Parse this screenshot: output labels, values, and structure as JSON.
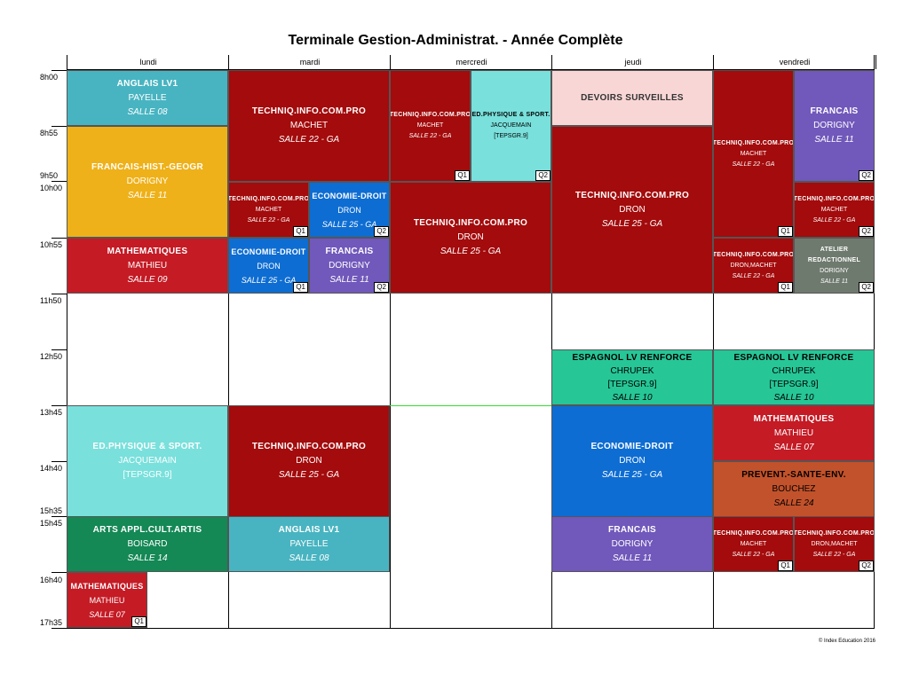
{
  "title": "Terminale Gestion-Administrat. - Année Complète",
  "days": [
    "lundi",
    "mardi",
    "mercredi",
    "jeudi",
    "vendredi"
  ],
  "times": [
    "8h00",
    "8h55",
    "9h50",
    "10h00",
    "10h55",
    "11h50",
    "12h50",
    "13h45",
    "14h40",
    "15h35",
    "15h45",
    "16h40",
    "17h35"
  ],
  "footer": "© Index Education 2016",
  "colors": {
    "teal": "#48b4c1",
    "orange": "#efb119",
    "red": "#c41b25",
    "darkred": "#a30b0c",
    "cyan": "#79e0dc",
    "pink": "#f9d6d6",
    "blue": "#0e6dd2",
    "purple": "#7158bb",
    "grey": "#6f7a6e",
    "green": "#26c697",
    "darkgreen": "#148855",
    "rust": "#c2522b"
  },
  "courses": [
    {
      "subject": "ANGLAIS LV1",
      "teacher": "PAYELLE",
      "room": "SALLE 08",
      "extra": "",
      "group": "",
      "color": "teal"
    },
    {
      "subject": "FRANCAIS-HIST.-GEOGR",
      "teacher": "DORIGNY",
      "room": "SALLE 11",
      "extra": "",
      "group": "",
      "color": "orange"
    },
    {
      "subject": "MATHEMATIQUES",
      "teacher": "MATHIEU",
      "room": "SALLE 09",
      "extra": "",
      "group": "",
      "color": "red"
    },
    {
      "subject": "ED.PHYSIQUE & SPORT.",
      "teacher": "JACQUEMAIN",
      "room": "",
      "extra": "[TEPSGR.9]",
      "group": "",
      "color": "cyan"
    },
    {
      "subject": "ARTS APPL.CULT.ARTIS",
      "teacher": "BOISARD",
      "room": "SALLE 14",
      "extra": "",
      "group": "",
      "color": "darkgreen"
    },
    {
      "subject": "MATHEMATIQUES",
      "teacher": "MATHIEU",
      "room": "SALLE 07",
      "extra": "",
      "group": "Q1",
      "color": "red"
    },
    {
      "subject": "TECHNIQ.INFO.COM.PRO",
      "teacher": "MACHET",
      "room": "SALLE 22 - GA",
      "extra": "",
      "group": "",
      "color": "darkred"
    },
    {
      "subject": "TECHNIQ.INFO.COM.PRO",
      "teacher": "MACHET",
      "room": "SALLE 22 - GA",
      "extra": "",
      "group": "Q1",
      "color": "darkred"
    },
    {
      "subject": "ECONOMIE-DROIT",
      "teacher": "DRON",
      "room": "SALLE 25 - GA",
      "extra": "",
      "group": "Q2",
      "color": "blue"
    },
    {
      "subject": "ECONOMIE-DROIT",
      "teacher": "DRON",
      "room": "SALLE 25 - GA",
      "extra": "",
      "group": "Q1",
      "color": "blue"
    },
    {
      "subject": "FRANCAIS",
      "teacher": "DORIGNY",
      "room": "SALLE 11",
      "extra": "",
      "group": "Q2",
      "color": "purple"
    },
    {
      "subject": "TECHNIQ.INFO.COM.PRO",
      "teacher": "DRON",
      "room": "SALLE 25 - GA",
      "extra": "",
      "group": "",
      "color": "darkred"
    },
    {
      "subject": "ANGLAIS LV1",
      "teacher": "PAYELLE",
      "room": "SALLE 08",
      "extra": "",
      "group": "",
      "color": "teal"
    },
    {
      "subject": "TECHNIQ.INFO.COM.PRO",
      "teacher": "MACHET",
      "room": "SALLE 22 - GA",
      "extra": "",
      "group": "Q1",
      "color": "darkred"
    },
    {
      "subject": "ED.PHYSIQUE & SPORT.",
      "teacher": "JACQUEMAIN",
      "room": "",
      "extra": "[TEPSGR.9]",
      "group": "Q2",
      "color": "cyan"
    },
    {
      "subject": "TECHNIQ.INFO.COM.PRO",
      "teacher": "DRON",
      "room": "SALLE 25 - GA",
      "extra": "",
      "group": "",
      "color": "darkred"
    },
    {
      "subject": "DEVOIRS SURVEILLES",
      "teacher": "",
      "room": "",
      "extra": "",
      "group": "",
      "color": "pink"
    },
    {
      "subject": "TECHNIQ.INFO.COM.PRO",
      "teacher": "DRON",
      "room": "SALLE 25 - GA",
      "extra": "",
      "group": "",
      "color": "darkred"
    },
    {
      "subject": "ESPAGNOL LV RENFORCE",
      "teacher": "CHRUPEK",
      "room": "SALLE 10",
      "extra": "[TEPSGR.9]",
      "group": "",
      "color": "green"
    },
    {
      "subject": "ECONOMIE-DROIT",
      "teacher": "DRON",
      "room": "SALLE 25 - GA",
      "extra": "",
      "group": "",
      "color": "blue"
    },
    {
      "subject": "FRANCAIS",
      "teacher": "DORIGNY",
      "room": "SALLE 11",
      "extra": "",
      "group": "",
      "color": "purple"
    },
    {
      "subject": "TECHNIQ.INFO.COM.PRO",
      "teacher": "MACHET",
      "room": "SALLE 22 - GA",
      "extra": "",
      "group": "Q1",
      "color": "darkred"
    },
    {
      "subject": "FRANCAIS",
      "teacher": "DORIGNY",
      "room": "SALLE 11",
      "extra": "",
      "group": "Q2",
      "color": "purple"
    },
    {
      "subject": "TECHNIQ.INFO.COM.PRO",
      "teacher": "MACHET",
      "room": "SALLE 22 - GA",
      "extra": "",
      "group": "Q2",
      "color": "darkred"
    },
    {
      "subject": "TECHNIQ.INFO.COM.PRO",
      "teacher": "DRON,MACHET",
      "room": "SALLE 22 - GA",
      "extra": "",
      "group": "Q1",
      "color": "darkred"
    },
    {
      "subject": "ATELIER REDACTIONNEL",
      "teacher": "DORIGNY",
      "room": "SALLE 11",
      "extra": "",
      "group": "Q2",
      "color": "grey"
    },
    {
      "subject": "ESPAGNOL LV RENFORCE",
      "teacher": "CHRUPEK",
      "room": "SALLE 10",
      "extra": "[TEPSGR.9]",
      "group": "",
      "color": "green"
    },
    {
      "subject": "MATHEMATIQUES",
      "teacher": "MATHIEU",
      "room": "SALLE 07",
      "extra": "",
      "group": "",
      "color": "red"
    },
    {
      "subject": "PREVENT.-SANTE-ENV.",
      "teacher": "BOUCHEZ",
      "room": "SALLE 24",
      "extra": "",
      "group": "",
      "color": "rust"
    },
    {
      "subject": "TECHNIQ.INFO.COM.PRO",
      "teacher": "MACHET",
      "room": "SALLE 22 - GA",
      "extra": "",
      "group": "Q1",
      "color": "darkred"
    },
    {
      "subject": "TECHNIQ.INFO.COM.PRO",
      "teacher": "DRON,MACHET",
      "room": "SALLE 22 - GA",
      "extra": "",
      "group": "Q2",
      "color": "darkred"
    }
  ]
}
